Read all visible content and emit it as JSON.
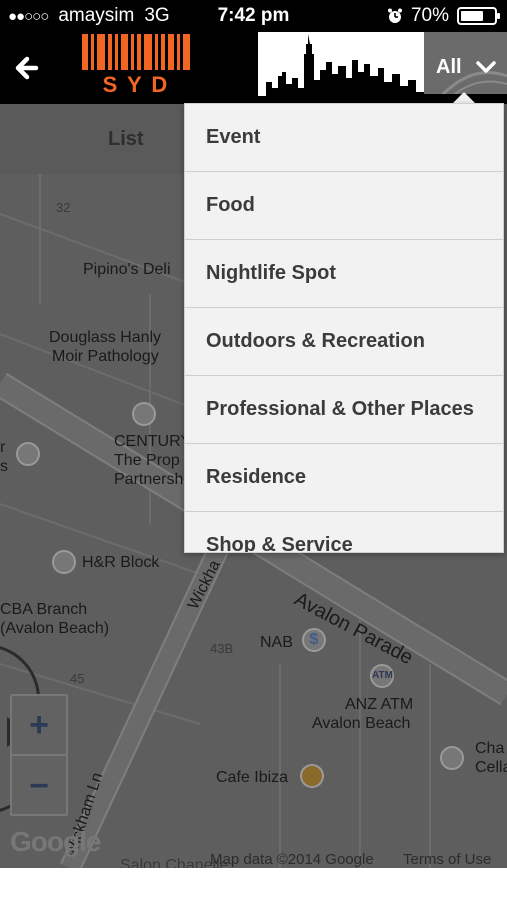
{
  "status_bar": {
    "signal_dots": "●●○○○",
    "carrier": "amaysim",
    "network": "3G",
    "time": "7:42 pm",
    "alarm_icon": "alarm-clock-icon",
    "battery_percent": "70%",
    "battery_level": 0.7
  },
  "header": {
    "back_icon": "arrow-left-icon",
    "logo_text": "S Y D",
    "filter_label": "All",
    "filter_icon": "chevron-down-icon",
    "accent_color": "#f26522"
  },
  "map": {
    "list_tab": "List",
    "labels": {
      "pipinos": "Pipino's Deli",
      "douglass_1": "Douglass Hanly",
      "douglass_2": "Moir Pathology",
      "century_1": "CENTURY",
      "century_2": "The Prop",
      "century_3": "Partnersh",
      "hr_block": "H&R Block",
      "cba_1": "CBA Branch",
      "cba_2": "(Avalon Beach)",
      "avalon_parade": "Avalon Parade",
      "wickham": "Wickha",
      "wickham_ln": "Wickham Ln",
      "nab": "NAB",
      "anz_1": "ANZ ATM",
      "anz_2": "Avalon Beach",
      "cafe_ibiza": "Cafe Ibiza",
      "cha_1": "Cha",
      "cha_2": "Cella",
      "edge_r": "r",
      "edge_s": "s",
      "atm_badge": "ATM",
      "dollar_badge": "$",
      "bottom_partial": "Salon Chanelle"
    },
    "numbers": {
      "n32": "32",
      "n43b": "43B",
      "n45": "45"
    },
    "zoom_in": "+",
    "zoom_out": "−",
    "google_logo": "Google",
    "map_data": "Map data ©2014 Google",
    "terms": "Terms of Use"
  },
  "dropdown": {
    "items": [
      "Event",
      "Food",
      "Nightlife Spot",
      "Outdoors & Recreation",
      "Professional & Other Places",
      "Residence",
      "Shop & Service"
    ]
  }
}
